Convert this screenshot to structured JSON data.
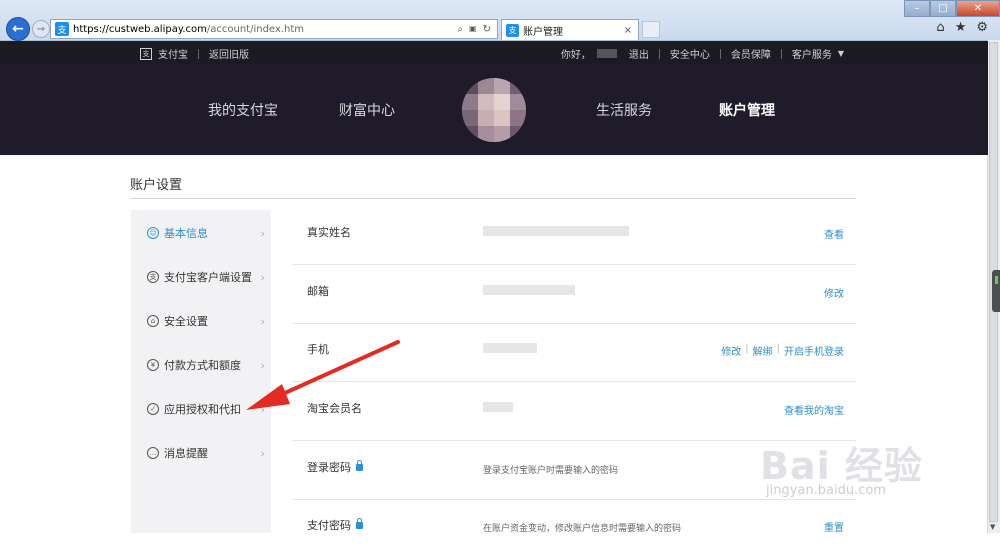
{
  "browser": {
    "url_scheme": "https://",
    "url_domain": "custweb.alipay.com",
    "url_path": "/account/index.htm",
    "tab_title": "账户管理",
    "tab_icon": "支",
    "address_icon": "支",
    "back_icon": "arrow-left-icon",
    "forward_icon": "arrow-right-icon",
    "tool_search": "⌕",
    "tool_lock": "🔒",
    "tool_refresh": "↻",
    "tab_close": "×",
    "home_icon": "⌂",
    "star_icon": "★",
    "gear_icon": "⚙",
    "minimize": "–",
    "maximize": "□",
    "close": "✕"
  },
  "top_strip": {
    "logo_mark": "支",
    "brand": "支付宝",
    "old_version": "返回旧版",
    "greeting": "你好，",
    "logout": "退出",
    "security_center": "安全中心",
    "member_protection": "会员保障",
    "customer_service": "客户服务"
  },
  "main_nav": {
    "items": [
      {
        "label": "我的支付宝",
        "active": false
      },
      {
        "label": "财富中心",
        "active": false
      },
      {
        "label": "生活服务",
        "active": false
      },
      {
        "label": "账户管理",
        "active": true
      }
    ]
  },
  "page": {
    "title": "账户设置"
  },
  "sidebar": {
    "items": [
      {
        "label": "基本信息",
        "icon": "user-icon",
        "glyph": "☺",
        "active": true
      },
      {
        "label": "支付宝客户端设置",
        "icon": "client-icon",
        "glyph": "支",
        "active": false
      },
      {
        "label": "安全设置",
        "icon": "lock-icon",
        "glyph": "⌂",
        "active": false
      },
      {
        "label": "付款方式和额度",
        "icon": "yen-icon",
        "glyph": "¥",
        "active": false
      },
      {
        "label": "应用授权和代扣",
        "icon": "check-icon",
        "glyph": "✓",
        "active": false
      },
      {
        "label": "消息提醒",
        "icon": "message-icon",
        "glyph": "…",
        "active": false
      }
    ],
    "chevron": "›"
  },
  "rows": [
    {
      "label": "真实姓名",
      "actions": [
        "查看"
      ]
    },
    {
      "label": "邮箱",
      "actions": [
        "修改"
      ]
    },
    {
      "label": "手机",
      "actions": [
        "修改",
        "解绑",
        "开启手机登录"
      ]
    },
    {
      "label": "淘宝会员名",
      "actions": [
        "查看我的淘宝"
      ]
    },
    {
      "label": "登录密码",
      "hint": "登录支付宝账户时需要输入的密码",
      "lock": true,
      "actions": [
        ""
      ]
    },
    {
      "label": "支付密码",
      "hint": "在账户资金变动，修改账户信息时需要输入的密码",
      "lock": true,
      "actions": [
        "重置"
      ]
    }
  ],
  "watermark": {
    "line1": "Bai 经验",
    "line2": "jingyan.baidu.com"
  },
  "colors": {
    "nav_bg": "#1f1b2a",
    "accent": "#2e8fd1",
    "arrow": "#e32b24"
  }
}
